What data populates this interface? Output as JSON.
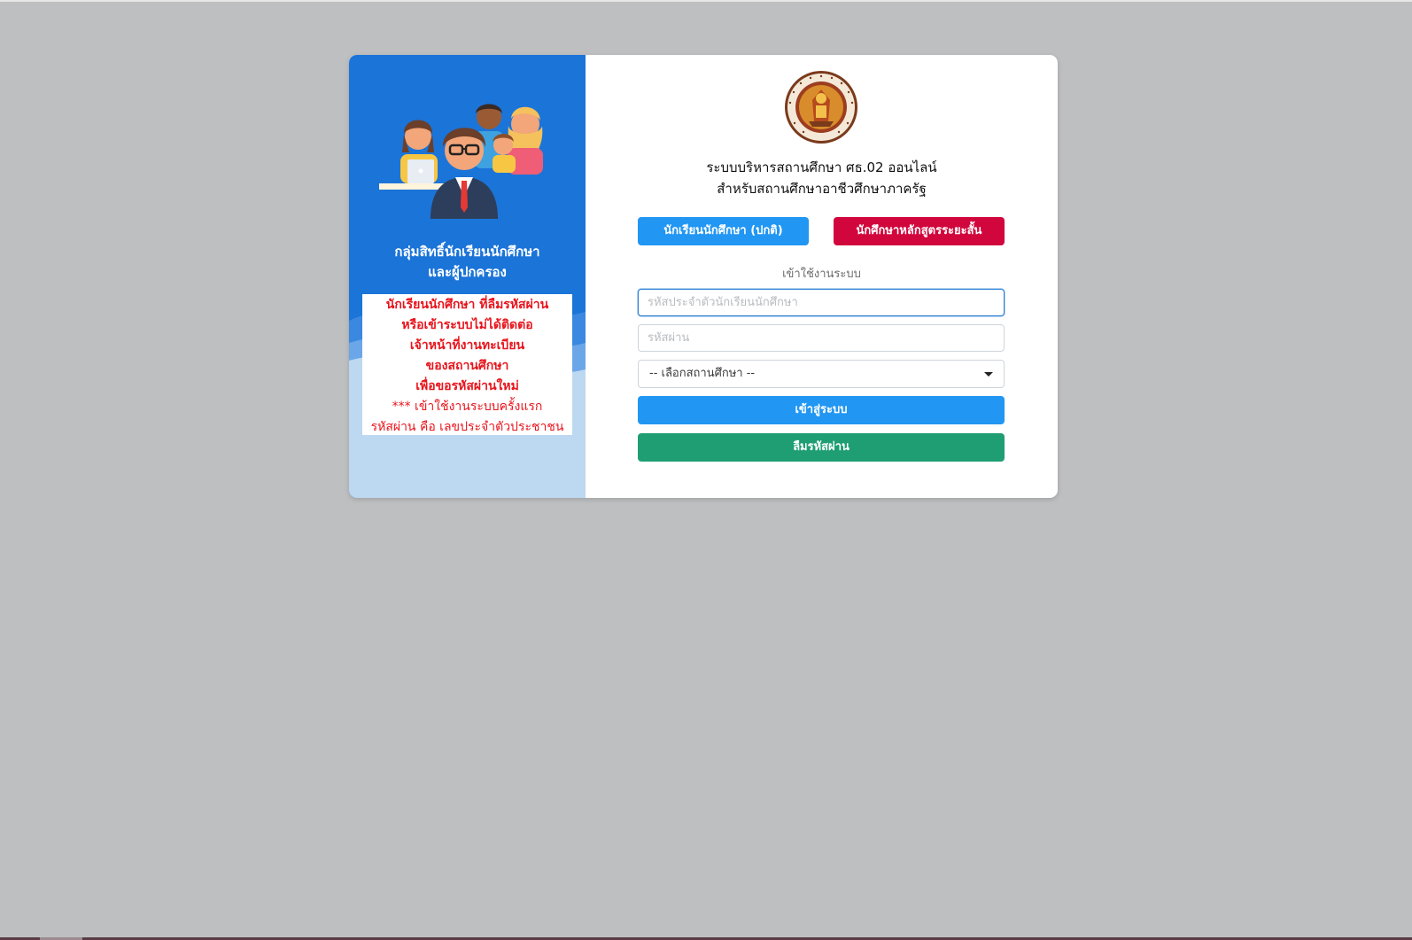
{
  "left": {
    "illustration_icon": "people-group-icon",
    "group_title_line1": "กลุ่มสิทธิ์นักเรียนนักศึกษา",
    "group_title_line2": "และผู้ปกครอง",
    "notice_lines_bold": [
      "นักเรียนนักศึกษา ที่ลืมรหัสผ่าน",
      "หรือเข้าระบบไม่ได้ติดต่อ",
      "เจ้าหน้าที่งานทะเบียน",
      "ของสถานศึกษา",
      "เพื่อขอรหัสผ่านใหม่"
    ],
    "notice_lines_normal": [
      "*** เข้าใช้งานระบบครั้งแรก",
      "รหัสผ่าน คือ เลขประจำตัวประชาชน"
    ],
    "panel_color": "#1b74d8",
    "notice_color": "#e8141c"
  },
  "right": {
    "logo_icon": "vocational-education-seal-icon",
    "title_line1": "ระบบบริหารสถานศึกษา ศธ.02 ออนไลน์",
    "title_line2": "สำหรับสถานศึกษาอาชีวศึกษาภาครัฐ",
    "tab_normal": "นักเรียนนักศึกษา (ปกติ)",
    "tab_short_course": "นักศึกษาหลักสูตรระยะสั้น",
    "login_label": "เข้าใช้งานระบบ",
    "username_placeholder": "รหัสประจำตัวนักเรียนนักศึกษา",
    "password_placeholder": "รหัสผ่าน",
    "school_select": "-- เลือกสถานศึกษา --",
    "login_button": "เข้าสู่ระบบ",
    "forgot_button": "ลืมรหัสผ่าน",
    "colors": {
      "primary": "#2196f3",
      "danger": "#d1063c",
      "success": "#1e9e72"
    }
  }
}
